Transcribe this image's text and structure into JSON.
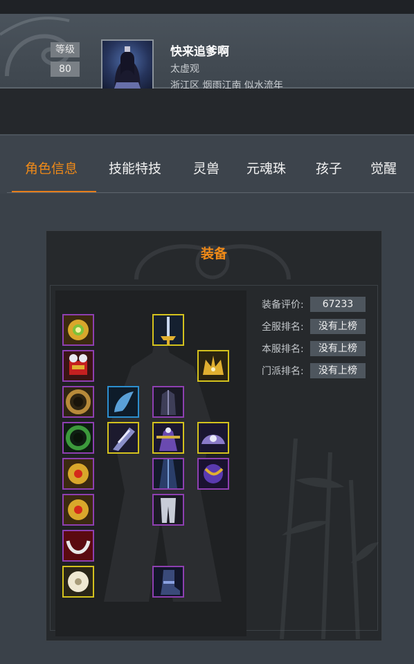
{
  "profile": {
    "level_label": "等级",
    "level_value": "80",
    "name": "快来追爹啊",
    "sect": "太虚观",
    "server": "浙江区 烟雨江南 似水流年"
  },
  "tabs": [
    {
      "label": "角色信息",
      "active": true
    },
    {
      "label": "技能特技",
      "active": false
    },
    {
      "label": "灵兽",
      "active": false
    },
    {
      "label": "元魂珠",
      "active": false
    },
    {
      "label": "孩子",
      "active": false
    },
    {
      "label": "觉醒",
      "active": false
    }
  ],
  "equipment": {
    "title": "装备",
    "stats": [
      {
        "label": "装备评价:",
        "value": "67233"
      },
      {
        "label": "全服排名:",
        "value": "没有上榜"
      },
      {
        "label": "本服排名:",
        "value": "没有上榜"
      },
      {
        "label": "门派排名:",
        "value": "没有上榜"
      }
    ],
    "slots": [
      {
        "name": "amulet-slot",
        "rarity": "purple"
      },
      {
        "name": "weapon-slot",
        "rarity": "gold"
      },
      {
        "name": "charm-slot",
        "rarity": "purple"
      },
      {
        "name": "helmet-slot",
        "rarity": "gold"
      },
      {
        "name": "ring-slot-1",
        "rarity": "purple"
      },
      {
        "name": "wing-slot",
        "rarity": "blue"
      },
      {
        "name": "armor-slot",
        "rarity": "purple"
      },
      {
        "name": "ring-slot-2",
        "rarity": "purple"
      },
      {
        "name": "offhand-slot",
        "rarity": "gold"
      },
      {
        "name": "costume-slot",
        "rarity": "gold"
      },
      {
        "name": "shoulder-slot",
        "rarity": "gold"
      },
      {
        "name": "earring-slot-1",
        "rarity": "purple"
      },
      {
        "name": "robe-slot",
        "rarity": "purple"
      },
      {
        "name": "belt-slot",
        "rarity": "purple"
      },
      {
        "name": "earring-slot-2",
        "rarity": "purple"
      },
      {
        "name": "pants-slot",
        "rarity": "purple"
      },
      {
        "name": "necklace-slot",
        "rarity": "purple"
      },
      {
        "name": "jade-slot",
        "rarity": "gold"
      },
      {
        "name": "boots-slot",
        "rarity": "purple"
      }
    ]
  },
  "colors": {
    "accent": "#f08a18",
    "background": "#3a4149",
    "purple_frame": "#8e3fb1",
    "gold_frame": "#d4c21d",
    "blue_frame": "#2c8fd0"
  }
}
